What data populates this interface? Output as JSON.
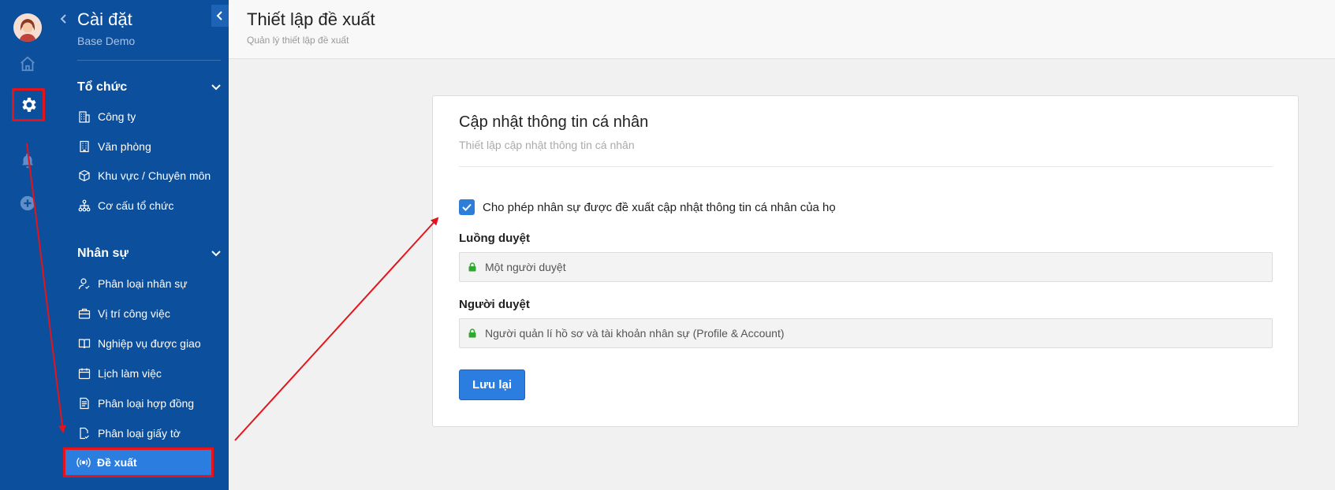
{
  "sidebar": {
    "title": "Cài đặt",
    "subtitle": "Base Demo",
    "sections": [
      {
        "label": "Tổ chức",
        "items": [
          {
            "label": "Công ty",
            "icon": "building-icon"
          },
          {
            "label": "Văn phòng",
            "icon": "office-icon"
          },
          {
            "label": "Khu vực / Chuyên môn",
            "icon": "cube-icon"
          },
          {
            "label": "Cơ cấu tổ chức",
            "icon": "org-chart-icon"
          }
        ]
      },
      {
        "label": "Nhân sự",
        "items": [
          {
            "label": "Phân loại nhân sự",
            "icon": "user-check-icon"
          },
          {
            "label": "Vị trí công việc",
            "icon": "briefcase-icon"
          },
          {
            "label": "Nghiệp vụ được giao",
            "icon": "book-icon"
          },
          {
            "label": "Lịch làm việc",
            "icon": "calendar-icon"
          },
          {
            "label": "Phân loại hợp đồng",
            "icon": "contract-icon"
          },
          {
            "label": "Phân loại giấy tờ",
            "icon": "document-check-icon"
          },
          {
            "label": "Đề xuất",
            "icon": "broadcast-icon",
            "active": true
          }
        ]
      }
    ]
  },
  "header": {
    "title": "Thiết lập đề xuất",
    "subtitle": "Quản lý thiết lập đề xuất"
  },
  "card": {
    "title": "Cập nhật thông tin cá nhân",
    "subtitle": "Thiết lập cập nhật thông tin cá nhân",
    "checkbox_label": "Cho phép nhân sự được đề xuất cập nhật thông tin cá nhân của họ",
    "checkbox_checked": true,
    "flow_label": "Luồng duyệt",
    "flow_value": "Một người duyệt",
    "approver_label": "Người duyệt",
    "approver_value": "Người quản lí hồ sơ và tài khoản nhân sự (Profile & Account)",
    "save_label": "Lưu lại"
  },
  "colors": {
    "sidebar_bg": "#0c4f9c",
    "accent": "#2b7de0",
    "highlight": "#e3141b",
    "lock": "#2fa82f"
  }
}
